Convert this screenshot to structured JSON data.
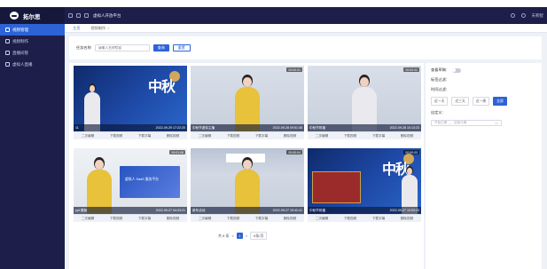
{
  "sidebar": {
    "brand": "拓尔思",
    "items": [
      {
        "label": "视频管理",
        "active": true
      },
      {
        "label": "视频制作",
        "active": false
      },
      {
        "label": "直播间管",
        "active": false
      },
      {
        "label": "虚拟人直播",
        "active": false
      }
    ]
  },
  "topbar": {
    "title": "虚拟人开放平台",
    "user": "天积智"
  },
  "tabs": [
    {
      "label": "主页",
      "active": true
    },
    {
      "label": "视频制作",
      "active": false,
      "close": "×"
    }
  ],
  "search": {
    "label": "任务名称",
    "placeholder": "请输入名称检索",
    "query_button": "查询",
    "reset_button": "重置"
  },
  "videos": [
    {
      "title": "11",
      "time": "2022-09-29 17:22:20",
      "duration": ""
    },
    {
      "title": "中秋节虚拟主播",
      "time": "2022-09-28 09:51:36",
      "duration": "00:00:01"
    },
    {
      "title": "中秋节祝福",
      "time": "2022-09-28 10:13:23",
      "duration": "00:00:02"
    },
    {
      "title": "ppt 模版",
      "time": "2022-09-27 04:03:21",
      "duration": "00:01:08"
    },
    {
      "title": "新年活动",
      "time": "2022-09-27 15:42:41",
      "duration": "00:00:04"
    },
    {
      "title": "中秋节祝福",
      "time": "2022-09-27 10:53:23",
      "duration": "00:00:03"
    }
  ],
  "card_actions": [
    "二次编辑",
    "下载视频",
    "下载字幕",
    "删除视频"
  ],
  "thumb_text": {
    "calligraphy": "中秋",
    "screen": "虚拟人 SaaS 服务平台",
    "sign": "新闻中心"
  },
  "pager": {
    "total": "共 8 条",
    "prev": "<",
    "page": "1",
    "next": ">",
    "size": "6条/页"
  },
  "filter": {
    "visible_label": "查看草稿：",
    "title_filter_label": "标签过滤：",
    "time_filter_label": "时间过滤：",
    "time_options": [
      {
        "label": "近一天",
        "active": false
      },
      {
        "label": "近三天",
        "active": false
      },
      {
        "label": "近一周",
        "active": false
      },
      {
        "label": "全部",
        "active": true
      }
    ],
    "custom_label": "自定义：",
    "start_placeholder": "开始日期",
    "separator": "—",
    "end_placeholder": "结束日期"
  }
}
